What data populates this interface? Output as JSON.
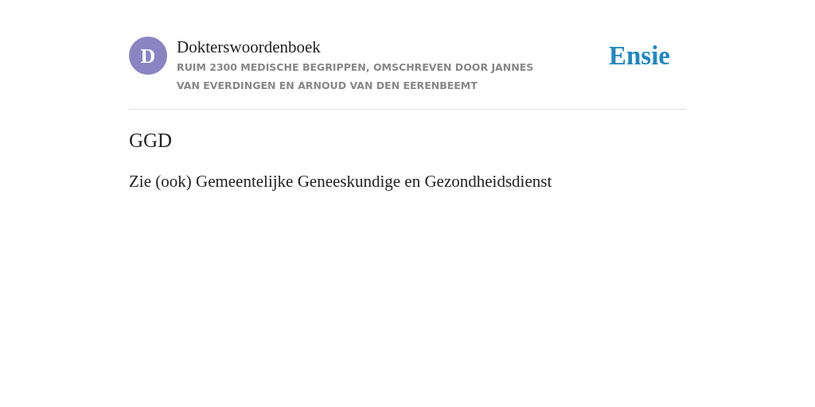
{
  "header": {
    "avatar_letter": "D",
    "title": "Dokterswoordenboek",
    "subtitle": "RUIM 2300 MEDISCHE BEGRIPPEN, OMSCHREVEN DOOR JANNES VAN EVERDINGEN EN ARNOUD VAN DEN EERENBEEMT",
    "logo": "Ensie"
  },
  "entry": {
    "term": "GGD",
    "definition": "Zie (ook) Gemeentelijke Geneeskundige en Gezondheidsdienst"
  }
}
